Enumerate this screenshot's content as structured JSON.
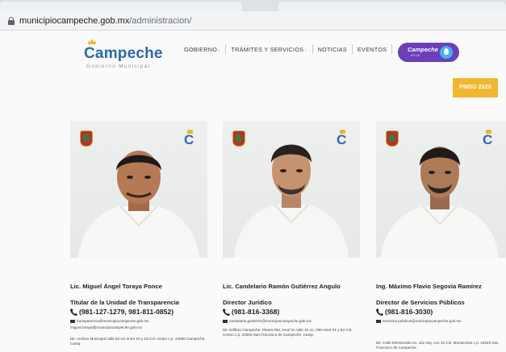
{
  "browser": {
    "url_host": "municipiocampeche.gob.mx",
    "url_path": "/administracion/"
  },
  "header": {
    "logo_name": "Campeche",
    "logo_subtitle": "Gobierno Municipal",
    "nav": [
      {
        "label": "GOBIERNO",
        "has_dropdown": true
      },
      {
        "label": "TRÁMITES Y SERVICIOS",
        "has_dropdown": true
      },
      {
        "label": "NOTICIAS",
        "has_dropdown": false
      },
      {
        "label": "EVENTOS",
        "has_dropdown": false
      }
    ],
    "campaign_badge_text": "Campeche",
    "campaign_badge_subtext": "en un",
    "pmdu_button": "PMDU 2020",
    "colors": {
      "brand_blue": "#2b6aa8",
      "badge_purple": "#6c3fb8",
      "pmdu_yellow": "#f2b731"
    }
  },
  "staff": [
    {
      "name": "Lic. Miguel Ángel Toraya Ponce",
      "role": "Titular de la Unidad de Transparencia",
      "phone": "(981-127-1279, 981-811-0852)",
      "email": "transparencia@municipiocampeche.gob.mx",
      "email2": "miguel.toraya@municipiocampeche.gob.mx",
      "address": "Dir. Archivo Municipal calle 63 s/n entre 16 y 18 Col. centro c.p. 24000 Campeche, Camp."
    },
    {
      "name": "Lic. Candelario Ramón Gutiérrez Angulo",
      "role": "Director Jurídico",
      "phone": "(981-816-3368)",
      "email": "candelario.gutierrez@municipiocampeche.gob.mx",
      "email2": "",
      "address": "Dir. Edificio Campeche, Planta Alta, local 3c calle 10 no. 268 entre 61 y 63 Col. Centro c.p. 24000 San Francisco de Campeche, Camp."
    },
    {
      "name": "Ing. Máximo Flavio Segovia Ramírez",
      "role": "Director de Servicios Públicos",
      "phone": "(981-816-3030)",
      "email": "servicios.publicos@municipiocampeche.gob.mx",
      "email2": "",
      "address": "Dir. Calle Montecristo no. 112 esq. con 12 Col. Montecristo c.p. 24040 San Francisco de Campeche"
    }
  ]
}
